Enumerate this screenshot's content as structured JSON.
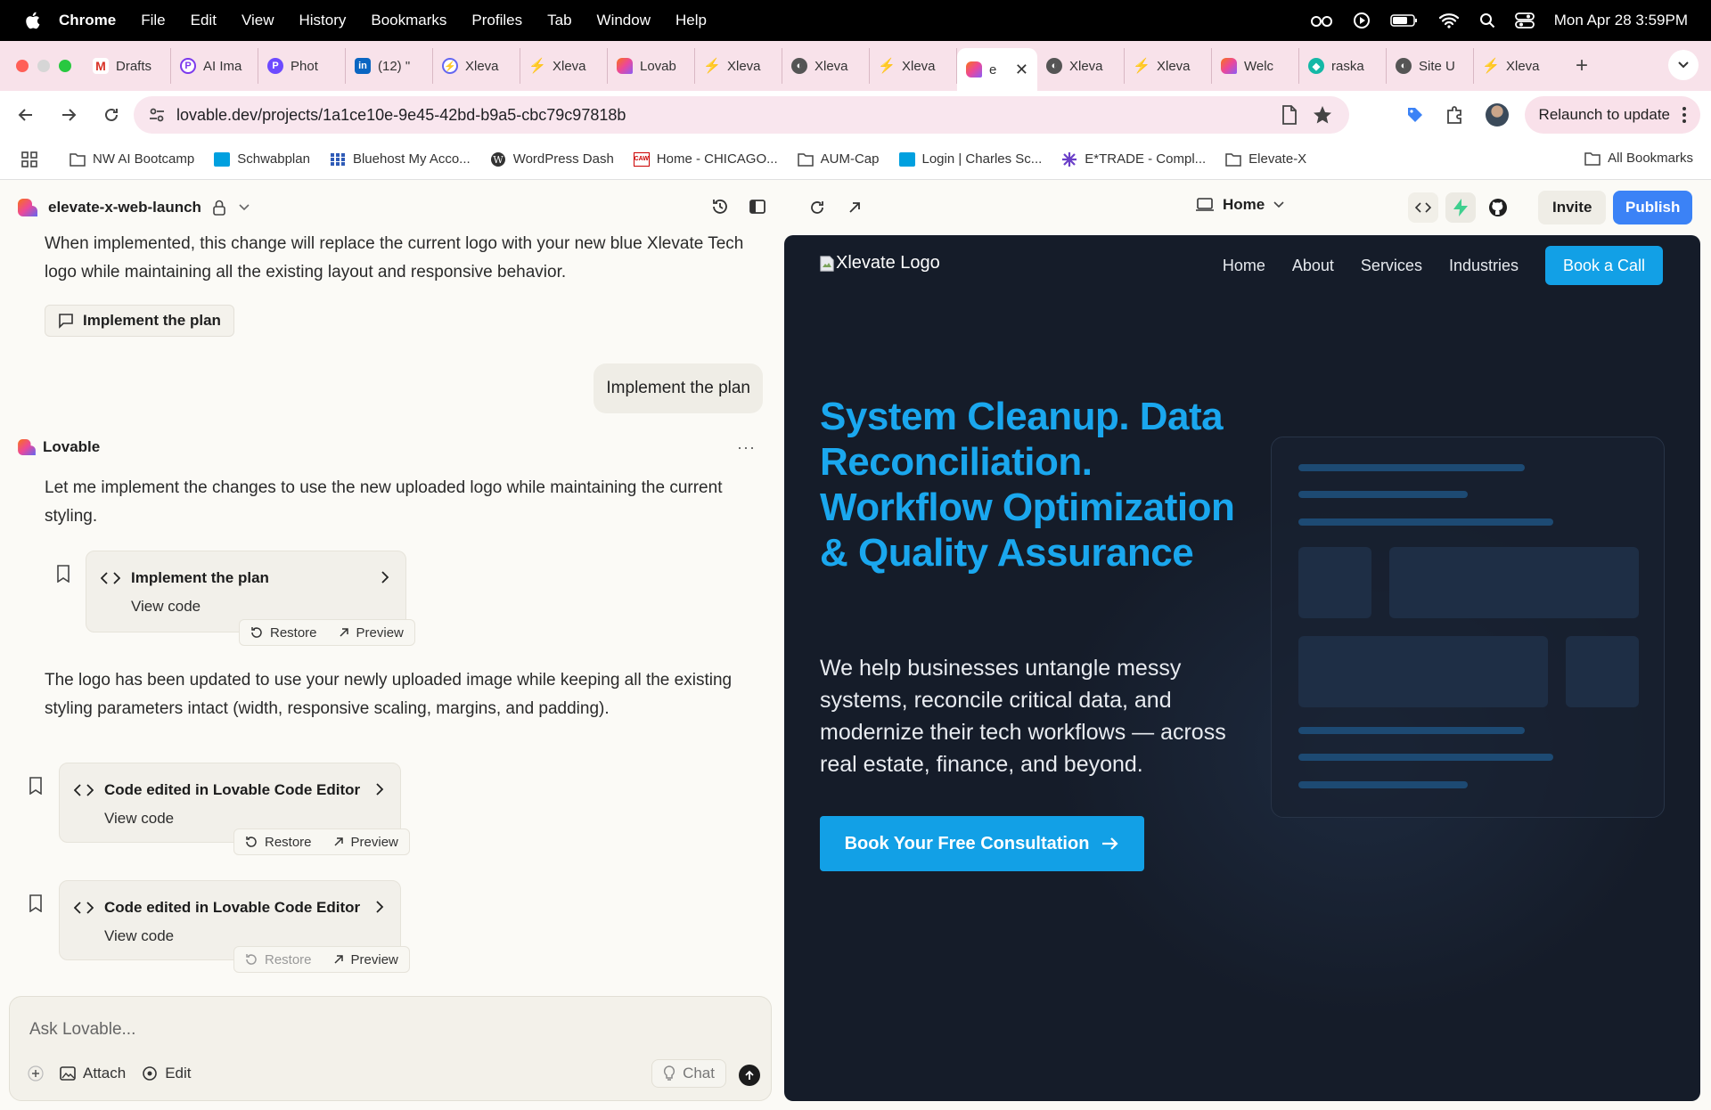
{
  "menubar": {
    "app_name": "Chrome",
    "items": [
      "File",
      "Edit",
      "View",
      "History",
      "Bookmarks",
      "Profiles",
      "Tab",
      "Window",
      "Help"
    ],
    "datetime": "Mon Apr 28  3:59PM"
  },
  "tabs": [
    {
      "label": "Drafts",
      "favicon": "gmail-icon",
      "color": "#d93025"
    },
    {
      "label": "AI Ima",
      "favicon": "p-icon",
      "color": "#7c3aed"
    },
    {
      "label": "Phot",
      "favicon": "p-icon",
      "color": "#6d4aff"
    },
    {
      "label": "(12) \"",
      "favicon": "linkedin-icon",
      "color": "#0a66c2"
    },
    {
      "label": "Xleva",
      "favicon": "spark-icon",
      "color": "#6366f1"
    },
    {
      "label": "Xleva",
      "favicon": "bolt-icon",
      "color": "#3b82f6"
    },
    {
      "label": "Lovab",
      "favicon": "lovable-icon",
      "color": "#f43f5e"
    },
    {
      "label": "Xleva",
      "favicon": "bolt-icon",
      "color": "#3b82f6"
    },
    {
      "label": "Xleva",
      "favicon": "globe-icon",
      "color": "#555555"
    },
    {
      "label": "Xleva",
      "favicon": "bolt-icon",
      "color": "#3b82f6"
    },
    {
      "label": "e",
      "favicon": "lovable-icon",
      "color": "#f43f5e",
      "active": true
    },
    {
      "label": "Xleva",
      "favicon": "globe-icon",
      "color": "#555555"
    },
    {
      "label": "Xleva",
      "favicon": "bolt-icon",
      "color": "#3b82f6"
    },
    {
      "label": "Welc",
      "favicon": "lovable-icon",
      "color": "#f43f5e"
    },
    {
      "label": "raska",
      "favicon": "diamond-icon",
      "color": "#14b8a6"
    },
    {
      "label": "Site U",
      "favicon": "globe-icon",
      "color": "#555555"
    },
    {
      "label": "Xleva",
      "favicon": "bolt-icon",
      "color": "#3b82f6"
    }
  ],
  "address": {
    "url": "lovable.dev/projects/1a1ce10e-9e45-42bd-b9a5-cbc79c97818b",
    "relaunch_label": "Relaunch to update"
  },
  "bookmarks": {
    "items": [
      "NW AI Bootcamp",
      "Schwabplan",
      "Bluehost My Acco...",
      "WordPress Dash",
      "Home - CHICAGO...",
      "AUM-Cap",
      "Login | Charles Sc...",
      "E*TRADE - Compl...",
      "Elevate-X"
    ],
    "all_label": "All Bookmarks"
  },
  "project": {
    "name": "elevate-x-web-launch"
  },
  "chat": {
    "msg1": "When implemented, this change will replace the current logo with your new blue Xlevate Tech logo while maintaining all the existing layout and responsive behavior.",
    "implement_chip": "Implement the plan",
    "user_message": "Implement the plan",
    "assistant_name": "Lovable",
    "msg2": "Let me implement the changes to use the new uploaded logo while maintaining the current styling.",
    "card1": {
      "title": "Implement the plan",
      "sub": "View code",
      "restore": "Restore",
      "preview": "Preview"
    },
    "msg3": "The logo has been updated to use your newly uploaded image while keeping all the existing styling parameters intact (width, responsive scaling, margins, and padding).",
    "card2": {
      "title": "Code edited in Lovable Code Editor",
      "sub": "View code",
      "restore": "Restore",
      "preview": "Preview"
    },
    "card3": {
      "title": "Code edited in Lovable Code Editor",
      "sub": "View code",
      "restore": "Restore",
      "preview": "Preview"
    },
    "input_placeholder": "Ask Lovable...",
    "attach_label": "Attach",
    "edit_label": "Edit",
    "chat_label": "Chat"
  },
  "preview_toolbar": {
    "page": "Home",
    "invite": "Invite",
    "publish": "Publish"
  },
  "site": {
    "logo_alt": "Xlevate Logo",
    "nav": [
      "Home",
      "About",
      "Services",
      "Industries"
    ],
    "book_call": "Book a Call",
    "hero_title": "System Cleanup. Data Reconciliation. Workflow Optimization & Quality Assurance",
    "hero_sub": "We help businesses untangle messy systems, reconcile critical data, and modernize their tech workflows — across real estate, finance, and beyond.",
    "cta": "Book Your Free Consultation"
  },
  "colors": {
    "accent": "#12a0e6",
    "publish": "#3b82f6",
    "site_bg": "#151c29",
    "tabstrip": "#f8e2ea"
  }
}
